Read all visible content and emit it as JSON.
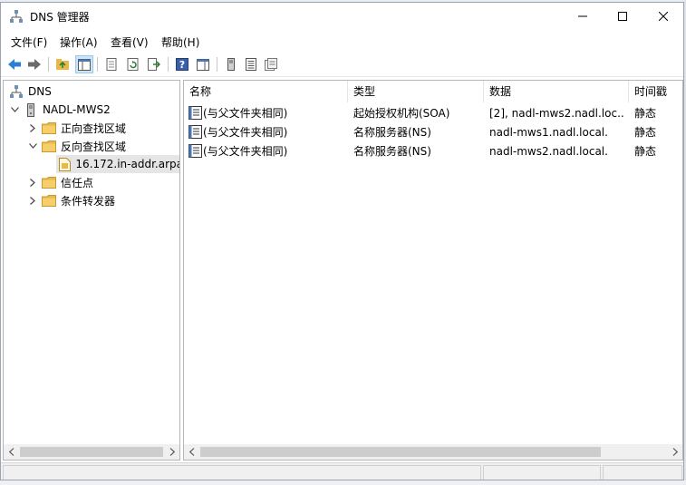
{
  "window": {
    "title": "DNS 管理器"
  },
  "menu": [
    {
      "label": "文件(F)"
    },
    {
      "label": "操作(A)"
    },
    {
      "label": "查看(V)"
    },
    {
      "label": "帮助(H)"
    }
  ],
  "tree": {
    "root": "DNS",
    "server": "NADL-MWS2",
    "forward_zone": "正向查找区域",
    "reverse_zone": "反向查找区域",
    "reverse_zone_child": "16.172.in-addr.arpa",
    "trust_points": "信任点",
    "conditional_forwarders": "条件转发器"
  },
  "list": {
    "columns": [
      "名称",
      "类型",
      "数据",
      "时间戳"
    ],
    "rows": [
      {
        "name": "(与父文件夹相同)",
        "type": "起始授权机构(SOA)",
        "data": "[2], nadl-mws2.nadl.loc...",
        "timestamp": "静态"
      },
      {
        "name": "(与父文件夹相同)",
        "type": "名称服务器(NS)",
        "data": "nadl-mws1.nadl.local.",
        "timestamp": "静态"
      },
      {
        "name": "(与父文件夹相同)",
        "type": "名称服务器(NS)",
        "data": "nadl-mws2.nadl.local.",
        "timestamp": "静态"
      }
    ]
  },
  "colors": {
    "accent": "#cce4f7",
    "folder": "#e8b94a",
    "selection": "#e5e5e5"
  }
}
